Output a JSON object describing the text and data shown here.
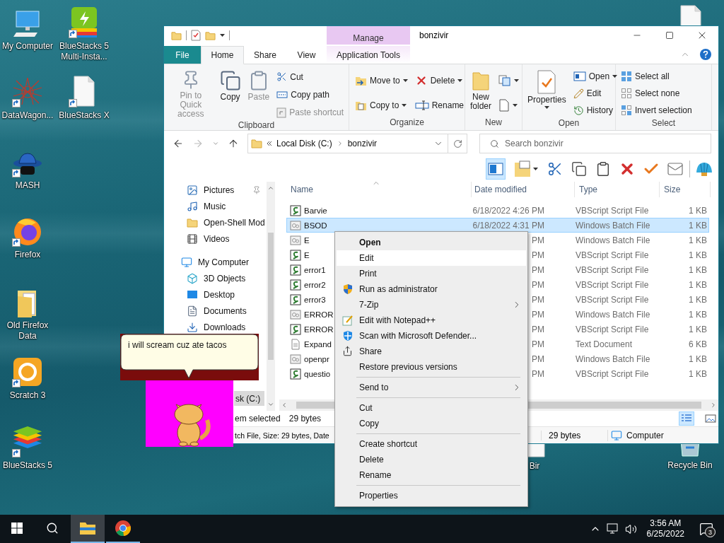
{
  "desktop_icons": [
    {
      "label": "My Computer",
      "shortcut": false
    },
    {
      "label": "BlueStacks 5 Multi-Insta...",
      "shortcut": true
    },
    {
      "label": "DataWagon...",
      "shortcut": true
    },
    {
      "label": "BlueStacks X",
      "shortcut": true
    },
    {
      "label": "MASH",
      "shortcut": true
    },
    {
      "label": "Firefox",
      "shortcut": true
    },
    {
      "label": "Old Firefox Data",
      "shortcut": false
    },
    {
      "label": "Scratch 3",
      "shortcut": true
    },
    {
      "label": "BlueStacks 5",
      "shortcut": true
    },
    {
      "label": "Bir",
      "shortcut": false
    },
    {
      "label": "Recycle Bin",
      "shortcut": false
    }
  ],
  "explorer": {
    "context_tab": "Manage",
    "title": "bonzivir",
    "tabs": [
      {
        "label": "File",
        "kind": "file",
        "selected": false
      },
      {
        "label": "Home",
        "kind": "plain",
        "selected": true
      },
      {
        "label": "Share",
        "kind": "plain",
        "selected": false
      },
      {
        "label": "View",
        "kind": "plain",
        "selected": false
      },
      {
        "label": "Application Tools",
        "kind": "context",
        "selected": false
      }
    ],
    "ribbon": [
      {
        "label": "Clipboard",
        "commands": [
          {
            "label": "Pin to Quick access",
            "kind": "large",
            "disabled": true,
            "dropdown": false
          },
          {
            "label": "Copy",
            "kind": "large",
            "disabled": false,
            "dropdown": false
          },
          {
            "label": "Paste",
            "kind": "large",
            "disabled": true,
            "dropdown": false
          },
          {
            "label": "Cut",
            "kind": "small",
            "disabled": false,
            "dropdown": false
          },
          {
            "label": "Copy path",
            "kind": "small",
            "disabled": false,
            "dropdown": false
          },
          {
            "label": "Paste shortcut",
            "kind": "small",
            "disabled": true,
            "dropdown": false
          }
        ]
      },
      {
        "label": "Organize",
        "commands": [
          {
            "label": "Move to",
            "kind": "medium",
            "disabled": false,
            "dropdown": true
          },
          {
            "label": "Copy to",
            "kind": "medium",
            "disabled": false,
            "dropdown": true
          },
          {
            "label": "Delete",
            "kind": "medium",
            "disabled": false,
            "dropdown": true
          },
          {
            "label": "Rename",
            "kind": "medium",
            "disabled": false,
            "dropdown": false
          }
        ]
      },
      {
        "label": "New",
        "commands": [
          {
            "label": "New folder",
            "kind": "large",
            "disabled": false,
            "dropdown": false
          },
          {
            "kind": "medium",
            "disabled": false,
            "dropdown": true
          },
          {
            "kind": "medium",
            "disabled": false,
            "dropdown": true
          }
        ]
      },
      {
        "label": "Open",
        "commands": [
          {
            "label": "Properties",
            "kind": "large",
            "disabled": false,
            "dropdown": true
          },
          {
            "label": "Open",
            "kind": "small",
            "disabled": false,
            "dropdown": true
          },
          {
            "label": "Edit",
            "kind": "small",
            "disabled": false,
            "dropdown": false
          },
          {
            "label": "History",
            "kind": "small",
            "disabled": false,
            "dropdown": false
          }
        ]
      },
      {
        "label": "Select",
        "commands": [
          {
            "label": "Select all",
            "kind": "small",
            "disabled": false,
            "dropdown": false
          },
          {
            "label": "Select none",
            "kind": "small",
            "disabled": false,
            "dropdown": false
          },
          {
            "label": "Invert selection",
            "kind": "small",
            "disabled": false,
            "dropdown": false
          }
        ]
      }
    ],
    "address": {
      "path": [
        "Local Disk (C:)",
        "bonzivir"
      ]
    },
    "search": {
      "placeholder": "Search bonzivir"
    },
    "nav": {
      "quick_access": [
        {
          "label": "Pictures",
          "pinned": true
        },
        {
          "label": "Music",
          "pinned": false
        },
        {
          "label": "Open-Shell Mod",
          "pinned": false
        },
        {
          "label": "Videos",
          "pinned": false
        }
      ],
      "tree": [
        {
          "label": "My Computer",
          "children": [
            {
              "label": "3D Objects",
              "selected": false,
              "clipped": false
            },
            {
              "label": "Desktop",
              "selected": false,
              "clipped": false
            },
            {
              "label": "Documents",
              "selected": false,
              "clipped": false
            },
            {
              "label": "Downloads",
              "selected": false,
              "clipped": false
            },
            {
              "label": "sk (C:)",
              "selected": true,
              "clipped": true
            }
          ]
        }
      ]
    },
    "columns": [
      "Name",
      "Date modified",
      "Type",
      "Size"
    ],
    "rows": [
      {
        "name": "Barvie",
        "date": "6/18/2022 4:26 PM",
        "type": "VBScript Script File",
        "size": "1 KB",
        "kind": "vbs",
        "selected": false
      },
      {
        "name": "BSOD",
        "date": "6/18/2022 4:31 PM",
        "type": "Windows Batch File",
        "size": "1 KB",
        "kind": "bat",
        "selected": true
      },
      {
        "name": "E",
        "date": "PM",
        "type": "Windows Batch File",
        "size": "1 KB",
        "kind": "bat",
        "selected": false
      },
      {
        "name": "E",
        "date": "PM",
        "type": "VBScript Script File",
        "size": "1 KB",
        "kind": "vbs",
        "selected": false
      },
      {
        "name": "error1",
        "date": "PM",
        "type": "VBScript Script File",
        "size": "1 KB",
        "kind": "vbs",
        "selected": false
      },
      {
        "name": "error2",
        "date": "PM",
        "type": "VBScript Script File",
        "size": "1 KB",
        "kind": "vbs",
        "selected": false
      },
      {
        "name": "error3",
        "date": "PM",
        "type": "VBScript Script File",
        "size": "1 KB",
        "kind": "vbs",
        "selected": false
      },
      {
        "name": "ERROR",
        "date": "PM",
        "type": "Windows Batch File",
        "size": "1 KB",
        "kind": "bat",
        "selected": false
      },
      {
        "name": "ERROR",
        "date": "PM",
        "type": "VBScript Script File",
        "size": "1 KB",
        "kind": "vbs",
        "selected": false
      },
      {
        "name": "Expand",
        "date": "PM",
        "type": "Text Document",
        "size": "6 KB",
        "kind": "txt",
        "selected": false
      },
      {
        "name": "openpr",
        "date": "PM",
        "type": "Windows Batch File",
        "size": "1 KB",
        "kind": "bat",
        "selected": false
      },
      {
        "name": "questio",
        "date": "PM",
        "type": "VBScript Script File",
        "size": "1 KB",
        "kind": "vbs",
        "selected": false
      }
    ],
    "status": {
      "selection": "em selected",
      "size": "29 bytes",
      "views": [
        {
          "selected": true
        },
        {
          "selected": false
        }
      ]
    },
    "details_bar": {
      "description": "tch File, Size: 29 bytes, Date",
      "size": "29 bytes",
      "location": "Computer"
    }
  },
  "context_menu": [
    {
      "kind": "item",
      "label": "Open",
      "bold": true,
      "highlighted": false,
      "submenu": false
    },
    {
      "kind": "item",
      "label": "Edit",
      "bold": false,
      "highlighted": true,
      "submenu": false
    },
    {
      "kind": "item",
      "label": "Print",
      "bold": false,
      "highlighted": false,
      "submenu": false
    },
    {
      "kind": "item",
      "label": "Run as administrator",
      "bold": false,
      "highlighted": false,
      "submenu": false
    },
    {
      "kind": "item",
      "label": "7-Zip",
      "bold": false,
      "highlighted": false,
      "submenu": true
    },
    {
      "kind": "item",
      "label": "Edit with Notepad++",
      "bold": false,
      "highlighted": false,
      "submenu": false
    },
    {
      "kind": "item",
      "label": "Scan with Microsoft Defender...",
      "bold": false,
      "highlighted": false,
      "submenu": false
    },
    {
      "kind": "item",
      "label": "Share",
      "bold": false,
      "highlighted": false,
      "submenu": false
    },
    {
      "kind": "item",
      "label": "Restore previous versions",
      "bold": false,
      "highlighted": false,
      "submenu": false
    },
    {
      "kind": "separator"
    },
    {
      "kind": "item",
      "label": "Send to",
      "bold": false,
      "highlighted": false,
      "submenu": true
    },
    {
      "kind": "separator"
    },
    {
      "kind": "item",
      "label": "Cut",
      "bold": false,
      "highlighted": false,
      "submenu": false
    },
    {
      "kind": "item",
      "label": "Copy",
      "bold": false,
      "highlighted": false,
      "submenu": false
    },
    {
      "kind": "separator"
    },
    {
      "kind": "item",
      "label": "Create shortcut",
      "bold": false,
      "highlighted": false,
      "submenu": false
    },
    {
      "kind": "item",
      "label": "Delete",
      "bold": false,
      "highlighted": false,
      "submenu": false
    },
    {
      "kind": "item",
      "label": "Rename",
      "bold": false,
      "highlighted": false,
      "submenu": false
    },
    {
      "kind": "separator"
    },
    {
      "kind": "item",
      "label": "Properties",
      "bold": false,
      "highlighted": false,
      "submenu": false
    }
  ],
  "buddy": {
    "speech": "i will scream cuz ate tacos"
  },
  "taskbar": {
    "apps": [
      {
        "active": true
      },
      {
        "active": false
      }
    ],
    "time": "3:56 AM",
    "date": "6/25/2022",
    "notifications": "3"
  }
}
